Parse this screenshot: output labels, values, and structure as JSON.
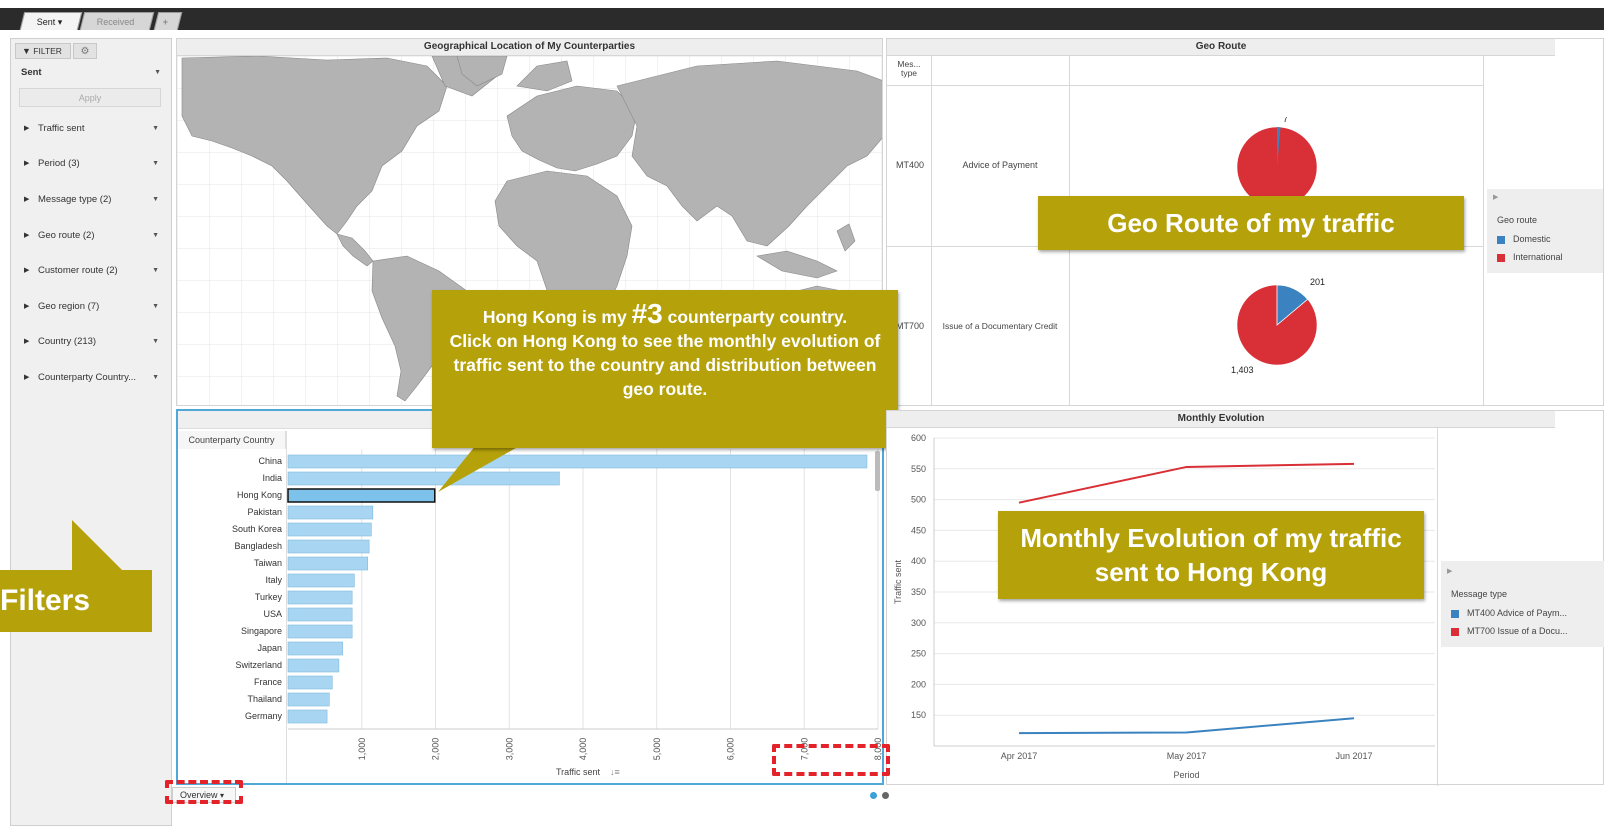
{
  "tabs": [
    {
      "label": "Sent",
      "caret": "▾"
    },
    {
      "label": "Received"
    }
  ],
  "add_tab_label": "+",
  "sidebar": {
    "filter_label": "FILTER",
    "dropdown_value": "Sent",
    "apply_label": "Apply",
    "items": [
      {
        "label": "Traffic sent"
      },
      {
        "label": "Period (3)"
      },
      {
        "label": "Message type (2)"
      },
      {
        "label": "Geo route (2)"
      },
      {
        "label": "Customer route (2)"
      },
      {
        "label": "Geo region (7)"
      },
      {
        "label": "Country (213)"
      },
      {
        "label": "Counterparty Country..."
      }
    ]
  },
  "filters_callout": "Filters",
  "map_panel": {
    "title": "Geographical Location of My Counterparties"
  },
  "geo_route_panel": {
    "title": "Geo Route",
    "header_col1": "Mes... type",
    "rows": [
      {
        "code": "MT400",
        "name": "Advice of Payment",
        "domestic": 7,
        "international": null,
        "domestic_label": "7"
      },
      {
        "code": "MT700",
        "name": "Issue of a Documentary Credit",
        "domestic": 201,
        "international": 1403,
        "domestic_label": "201",
        "international_label": "1,403"
      }
    ],
    "legend": {
      "title": "Geo route",
      "items": [
        {
          "label": "Domestic",
          "color": "#3b83c0"
        },
        {
          "label": "International",
          "color": "#d92f36"
        }
      ]
    },
    "callout": "Geo Route of my traffic"
  },
  "hk_callout": {
    "line1_a": "Hong Kong is my",
    "line1_num": "#3",
    "line1_b": "counterparty country.",
    "line2": "Click on Hong Kong to see the monthly evolution of traffic sent to the country and distribution between geo route."
  },
  "bar_panel": {
    "col_header": "Counterparty Country",
    "xlabel": "Traffic sent",
    "sort_icon": "sort-icon"
  },
  "monthly_panel": {
    "title": "Monthly Evolution",
    "callout": "Monthly Evolution of my traffic  sent to Hong Kong",
    "legend": {
      "title": "Message type",
      "items": [
        {
          "label": "MT400 Advice of Paym...",
          "color": "#3b83c0"
        },
        {
          "label": "MT700 Issue of a Docu...",
          "color": "#d92f36"
        }
      ]
    }
  },
  "bottom": {
    "overview_label": "Overview",
    "overview_caret": "▾"
  },
  "chart_data": [
    {
      "type": "bar",
      "orientation": "horizontal",
      "categories": [
        "China",
        "India",
        "Hong Kong",
        "Pakistan",
        "South Korea",
        "Bangladesh",
        "Taiwan",
        "Italy",
        "Turkey",
        "USA",
        "Singapore",
        "Japan",
        "Switzerland",
        "France",
        "Thailand",
        "Germany"
      ],
      "values": [
        7850,
        3680,
        1990,
        1150,
        1130,
        1100,
        1080,
        900,
        870,
        870,
        870,
        740,
        690,
        600,
        560,
        530
      ],
      "highlight": "Hong Kong",
      "xlabel": "Traffic sent",
      "xlim": [
        0,
        8000
      ],
      "xticks": [
        "1,000",
        "2,000",
        "3,000",
        "4,000",
        "5,000",
        "6,000",
        "7,000",
        "8,000"
      ],
      "grid": true
    },
    {
      "type": "line",
      "x": [
        "Apr 2017",
        "May 2017",
        "Jun 2017"
      ],
      "series": [
        {
          "name": "MT700 Issue of a Docu...",
          "values": [
            495,
            553,
            558
          ],
          "color": "#d92f36"
        },
        {
          "name": "MT400 Advice of Paym...",
          "values": [
            121,
            122,
            145
          ],
          "color": "#3b83c0"
        }
      ],
      "xlabel": "Period",
      "ylabel": "Traffic sent",
      "ylim": [
        100,
        600
      ],
      "yticks": [
        "150",
        "200",
        "250",
        "300",
        "350",
        "400",
        "450",
        "500",
        "550",
        "600"
      ],
      "grid": true
    },
    {
      "type": "pie",
      "rows": [
        "MT400",
        "MT700"
      ],
      "labels": [
        "Domestic",
        "International"
      ],
      "colors": [
        "#3b83c0",
        "#d92f36"
      ]
    }
  ]
}
